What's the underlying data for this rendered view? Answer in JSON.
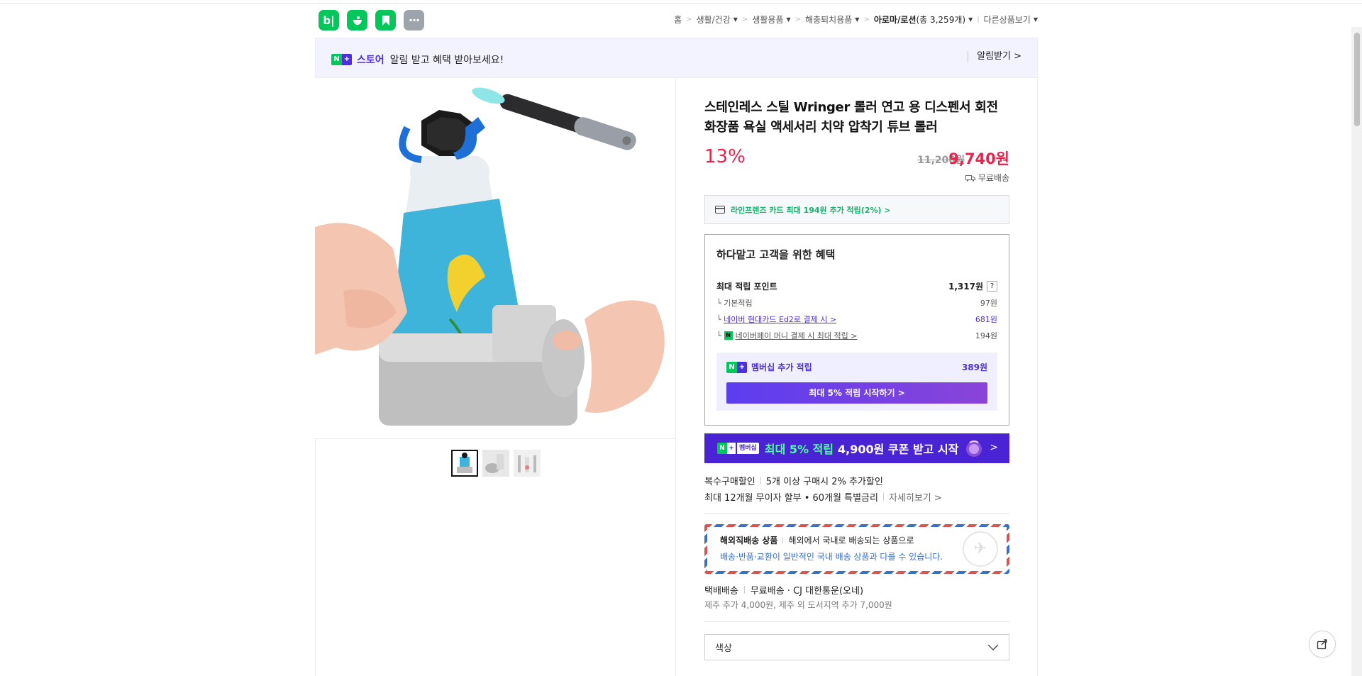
{
  "app_icons": [
    "b|",
    "pot",
    "bookmark",
    "···"
  ],
  "breadcrumb": {
    "items": [
      "홈",
      "생활/건강",
      "생활용품",
      "해충퇴치용품",
      "아로마/로션",
      "다른상품보기"
    ],
    "count": "(총 3,259개)"
  },
  "banner": {
    "n_badge": "N",
    "plus_badge": "+",
    "store": "스토어",
    "message": "알림 받고 혜택 받아보세요!",
    "alarm_label": "알림받기 >"
  },
  "product": {
    "title": "스테인레스 스틸 Wringer 롤러 연고 용 디스펜서 회전 화장품 욕실 액세서리 치약 압착기 튜브 롤러",
    "discount": "13%",
    "original_price": "11,200원",
    "price": "9,740원",
    "shipping_tag": "무료배송"
  },
  "card_offer": "라인프렌즈 카드 최대 194원 추가 적립(2%) >",
  "benefits": {
    "title": "하다맡고 고객을 위한 혜택",
    "max_point_label": "최대 적립 포인트",
    "max_point_value": "1,317원",
    "help": "?",
    "rows": [
      {
        "label": "기본적립",
        "value": "97원"
      },
      {
        "label": "네이버 현대카드 Ed2로 결제 시 >",
        "value": "681원"
      },
      {
        "label": "네이버페이 머니 결제 시 최대 적립 >",
        "value": "194원"
      }
    ],
    "membership_label": "멤버십 추가 적립",
    "membership_value": "389원",
    "membership_button": "최대 5% 적립 시작하기 >"
  },
  "coupon_banner": {
    "badge": "멤버십",
    "highlight": "최대 5% 적립",
    "text": "4,900원 쿠폰 받고 시작",
    "arrow": ">"
  },
  "multi_discount": {
    "label": "복수구매할인",
    "value": "5개 이상 구매시 2% 추가할인"
  },
  "installment": {
    "label": "최대 12개월 무이자 할부 • 60개월 특별금리",
    "link": "자세히보기 >"
  },
  "overseas": {
    "title": "해외직배송 상품",
    "line1": "해외에서 국내로 배송되는 상품으로",
    "line2": "배송·반품·교환이 일반적인 국내 배송 상품과 다를 수 있습니다."
  },
  "shipping": {
    "type": "택배배송",
    "detail": "무료배송 · CJ 대한통운(오네)",
    "extra": "제주 추가 4,000원, 제주 외 도서지역 추가 7,000원"
  },
  "option_select": {
    "label": "색상"
  },
  "colors": {
    "naver_green": "#03c75a",
    "purple": "#4e2fd8",
    "sale_red": "#e8244c"
  }
}
